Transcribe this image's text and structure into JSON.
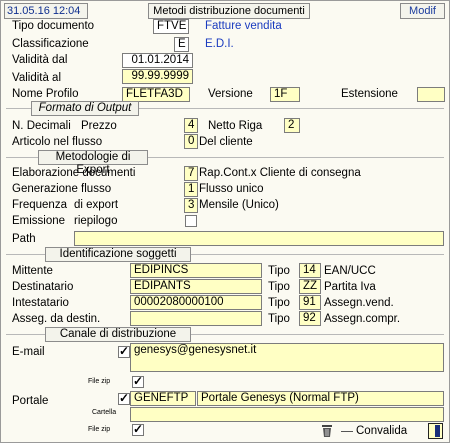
{
  "header": {
    "date": "31.05.16 12:04",
    "title": "Metodi distribuzione documenti",
    "mode": "Modif"
  },
  "doc": {
    "tipo_label": "Tipo documento",
    "tipo_value": "FTVE",
    "tipo_desc": "Fatture vendita",
    "class_label": "Classificazione",
    "class_value": "E",
    "class_desc": "E.D.I.",
    "vdal_label": "Validità dal",
    "vdal_value": "01.01.2014",
    "val_label": "Validità  al",
    "val_value": "99.99.9999",
    "profilo_label": "Nome Profilo",
    "profilo_value": "FLETFA3D",
    "versione_label": "Versione",
    "versione_value": "1F",
    "estensione_label": "Estensione",
    "estensione_value": ""
  },
  "output": {
    "section": "Formato di Output",
    "decimali_label": "N. Decimali",
    "prezzo_label": "Prezzo",
    "prezzo_value": "4",
    "netto_label": "Netto Riga",
    "netto_value": "2",
    "articolo_label": "Articolo nel flusso",
    "articolo_value": "0",
    "articolo_desc": "Del cliente"
  },
  "export": {
    "section": "Metodologie di Export",
    "elab_label": "Elaborazione documenti",
    "elab_value": "7",
    "elab_desc": "Rap.Cont.x Cliente di consegna",
    "gen_label": "Generazione  flusso",
    "gen_value": "1",
    "gen_desc": "Flusso unico",
    "freq_label": "Frequenza",
    "freq_label2": "di export",
    "freq_value": "3",
    "freq_desc": "Mensile (Unico)",
    "emissione_label": "Emissione",
    "riepilogo_label": "riepilogo",
    "riepilogo_checked": false,
    "path_label": "Path",
    "path_value": ""
  },
  "soggetti": {
    "section": "Identificazione soggetti",
    "mittente_label": "Mittente",
    "mittente_value": "EDIPINCS",
    "mittente_tipo": "14",
    "mittente_desc": "EAN/UCC",
    "dest_label": "Destinatario",
    "dest_value": "EDIPANTS",
    "dest_tipo": "ZZ",
    "dest_desc": "Partita Iva",
    "intest_label": "Intestatario",
    "intest_value": "00002080000100",
    "intest_tipo": "91",
    "intest_desc": "Assegn.vend.",
    "asseg_label": "Asseg. da destin.",
    "asseg_value": "",
    "asseg_tipo": "92",
    "asseg_desc": "Assegn.compr.",
    "tipo_label": "Tipo"
  },
  "canale": {
    "section": "Canale di distribuzione",
    "email_label": "E-mail",
    "email_checked": true,
    "email_value": "genesys@genesysnet.it",
    "filezip_label": "File zip",
    "filezip1_checked": true,
    "portale_label": "Portale",
    "portale_checked": true,
    "portale_code": "GENEFTP",
    "portale_desc": "Portale Genesys (Normal FTP)",
    "cartella_label": "Cartella",
    "cartella_value": "",
    "filezip2_checked": true,
    "convalida_label": "Convalida"
  },
  "icons": {
    "trash": "trash-icon",
    "exit": "exit-door-icon"
  }
}
